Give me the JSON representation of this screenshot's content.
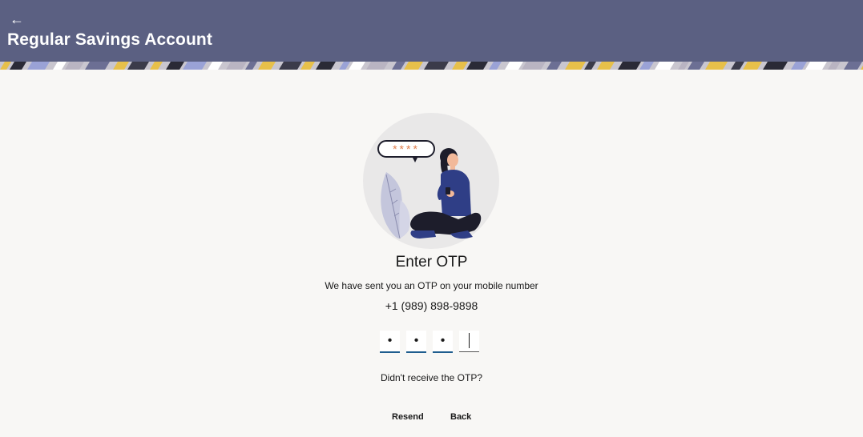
{
  "header": {
    "back_icon": "arrow-left-icon",
    "back_glyph": "←",
    "title": "Regular Savings Account",
    "background_color": "#5b6082"
  },
  "otp": {
    "illustration_icon": "person-with-phone-illustration",
    "bubble_text": "****",
    "title": "Enter OTP",
    "message": "We have sent you an OTP on your mobile number",
    "phone": "+1 (989) 898-9898",
    "digits": [
      "•",
      "•",
      "•",
      ""
    ],
    "active_index": 3,
    "not_received": "Didn't receive the OTP?",
    "resend_label": "Resend",
    "back_label": "Back",
    "accent_color": "#1f5d8e"
  }
}
